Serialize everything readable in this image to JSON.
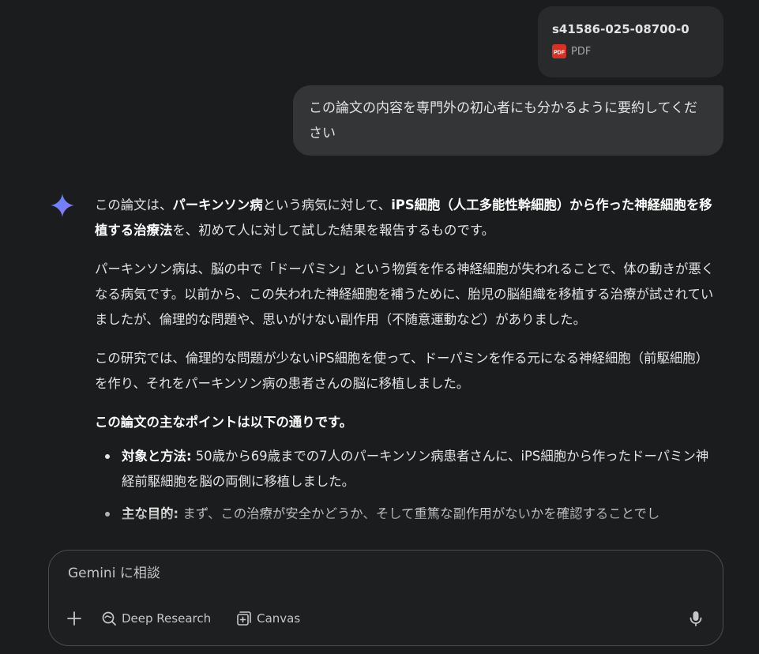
{
  "attachment": {
    "file_name": "s41586-025-08700-0",
    "file_type": "PDF"
  },
  "user_message": {
    "text": "この論文の内容を専門外の初心者にも分かるように要約してください"
  },
  "response": {
    "p1": {
      "t1": "この論文は、",
      "b1": "パーキンソン病",
      "t2": "という病気に対して、",
      "b2": "iPS細胞（人工多能性幹細胞）から作った神経細胞を移植する治療法",
      "t3": "を、初めて人に対して試した結果を報告するものです。"
    },
    "p2": "パーキンソン病は、脳の中で「ドーパミン」という物質を作る神経細胞が失われることで、体の動きが悪くなる病気です。以前から、この失われた神経細胞を補うために、胎児の脳組織を移植する治療が試されていましたが、倫理的な問題や、思いがけない副作用（不随意運動など）がありました。",
    "p3": "この研究では、倫理的な問題が少ないiPS細胞を使って、ドーパミンを作る元になる神経細胞（前駆細胞）を作り、それをパーキンソン病の患者さんの脳に移植しました。",
    "points_heading": "この論文の主なポイントは以下の通りです。",
    "bullets": [
      {
        "label": "対象と方法:",
        "text": " 50歳から69歳までの7人のパーキンソン病患者さんに、iPS細胞から作ったドーパミン神経前駆細胞を脳の両側に移植しました。"
      },
      {
        "label": "主な目的:",
        "text": " まず、この治療が安全かどうか、そして重篤な副作用がないかを確認することでし"
      }
    ]
  },
  "input": {
    "placeholder": "Gemini に相談"
  },
  "tools": {
    "deep_research": "Deep Research",
    "canvas": "Canvas"
  },
  "colors": {
    "background": "#1b1c1d",
    "bubble": "#333537",
    "card": "#282a2c",
    "pdf_red": "#d93025",
    "spark_blue": "#5b8cff"
  }
}
